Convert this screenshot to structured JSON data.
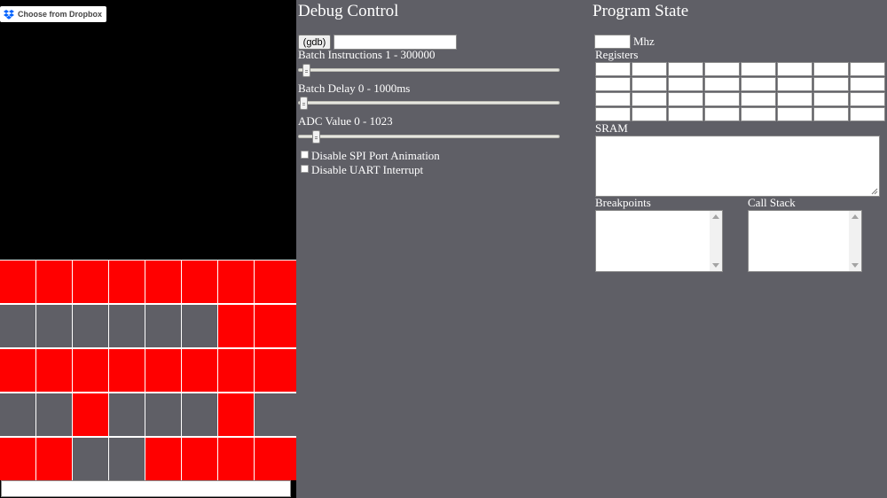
{
  "dropbox": {
    "label": "Choose from Dropbox",
    "icon": "dropbox-icon"
  },
  "colors": {
    "led_on": "#ff0000",
    "led_off": "#5f5f66",
    "panel_bg": "#5f5f66",
    "screen_bg": "#000000"
  },
  "led_matrix": {
    "rows": [
      [
        1,
        1,
        1,
        1,
        1,
        1,
        1,
        1
      ],
      [
        0,
        0,
        0,
        0,
        0,
        0,
        1,
        1
      ],
      [
        1,
        1,
        1,
        1,
        1,
        1,
        1,
        1
      ],
      [
        0,
        0,
        1,
        0,
        0,
        0,
        1,
        0
      ],
      [
        1,
        1,
        0,
        0,
        1,
        1,
        1,
        1
      ]
    ]
  },
  "uart": {
    "value": ""
  },
  "debug": {
    "title": "Debug Control",
    "gdb_label": "(gdb)",
    "gdb_value": "",
    "batch_instructions_label": "Batch Instructions 1 - 300000",
    "batch_delay_label": "Batch Delay 0 - 1000ms",
    "adc_label": "ADC Value 0 - 1023",
    "batch_instructions_value": 0.01,
    "batch_delay_value": 0.0,
    "adc_value": 0.05,
    "disable_spi_label": "Disable SPI Port Animation",
    "disable_uart_label": "Disable UART Interrupt"
  },
  "program": {
    "title": "Program State",
    "mhz_label": "Mhz",
    "mhz_value": "",
    "registers_label": "Registers",
    "sram_label": "SRAM",
    "breakpoints_label": "Breakpoints",
    "callstack_label": "Call Stack"
  }
}
